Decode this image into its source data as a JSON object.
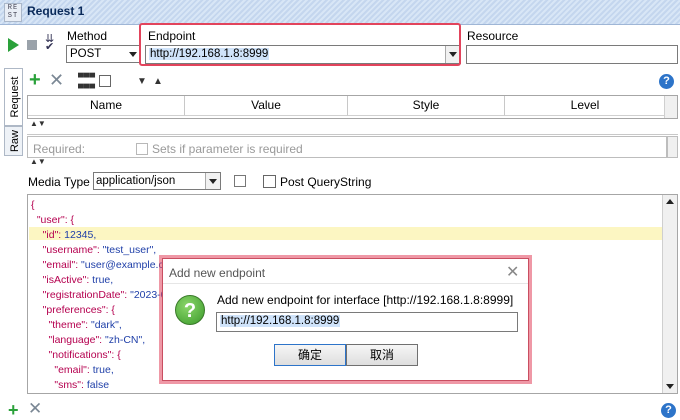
{
  "window": {
    "icon_text": "RE ST",
    "title": "Request 1"
  },
  "toolbar": {
    "method_label": "Method",
    "method_value": "POST",
    "endpoint_label": "Endpoint",
    "endpoint_value": "http://192.168.1.8:8999",
    "resource_label": "Resource",
    "resource_value": ""
  },
  "side_tabs": [
    "Request",
    "Raw"
  ],
  "params": {
    "columns": [
      "Name",
      "Value",
      "Style",
      "Level"
    ],
    "required_label": "Required:",
    "required_desc": "Sets if parameter is required"
  },
  "media": {
    "label": "Media Type",
    "value": "application/json",
    "post_qs_label": "Post QueryString"
  },
  "editor": {
    "lines": [
      {
        "text": "{",
        "type": "p"
      },
      {
        "text": "  \"user\": {",
        "type": "k"
      },
      {
        "key": "    \"id\"",
        "val": " 12345,"
      },
      {
        "key": "    \"username\"",
        "val": " \"test_user\","
      },
      {
        "key": "    \"email\"",
        "val": " \"user@example.com\","
      },
      {
        "key": "    \"isActive\"",
        "val": " true,"
      },
      {
        "key": "    \"registrationDate\"",
        "val": " \"2023-05"
      },
      {
        "text": "    \"preferences\": {",
        "type": "k"
      },
      {
        "key": "      \"theme\"",
        "val": " \"dark\","
      },
      {
        "key": "      \"language\"",
        "val": " \"zh-CN\","
      },
      {
        "text": "      \"notifications\": {",
        "type": "k"
      },
      {
        "key": "        \"email\"",
        "val": " true,"
      },
      {
        "key": "        \"sms\"",
        "val": " false"
      }
    ]
  },
  "dialog": {
    "title": "Add new endpoint",
    "message": "Add new endpoint for interface [http://192.168.1.8:8999]",
    "input_value": "http://192.168.1.8:8999",
    "ok_label": "确定",
    "cancel_label": "取消"
  },
  "colors": {
    "highlight_border": "#e2445c",
    "run_green": "#2aa13a",
    "help_blue": "#2d74c9"
  },
  "icons": [
    "rest-icon",
    "run-icon",
    "stop-icon",
    "submit-icon",
    "add-icon",
    "remove-icon",
    "properties-icon",
    "grid-icon",
    "move-down-icon",
    "move-up-icon",
    "help-icon",
    "question-icon",
    "close-icon"
  ]
}
